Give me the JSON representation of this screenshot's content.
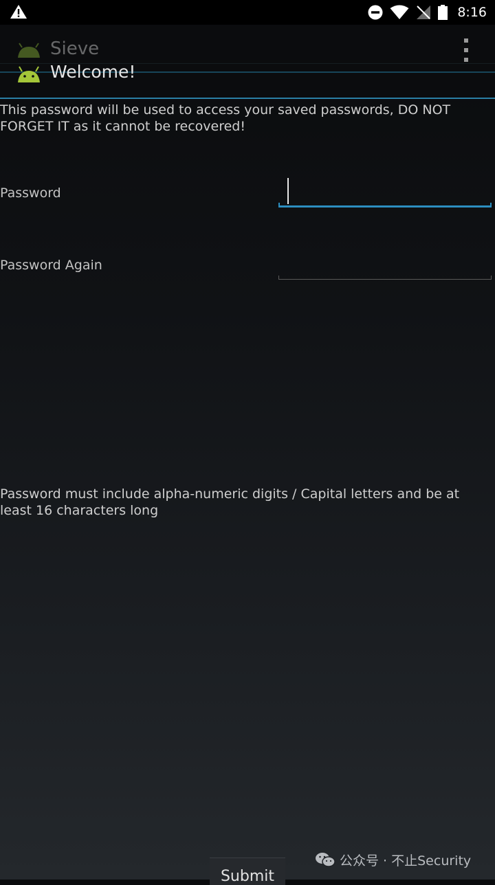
{
  "status_bar": {
    "time": "8:16",
    "icons": [
      "warning-icon",
      "do-not-disturb-icon",
      "wifi-icon",
      "no-signal-icon",
      "battery-icon"
    ]
  },
  "action_bar": {
    "app_title": "Sieve",
    "page_title": "Welcome!",
    "menu_icon": "overflow-menu-icon"
  },
  "form": {
    "intro_text": "This password will be used to access your saved passwords, DO NOT FORGET IT as it cannot be recovered!",
    "password_label": "Password",
    "password_value": "",
    "password_again_label": "Password Again",
    "password_again_value": "",
    "hint_text": "Password must include alpha-numeric digits / Capital letters and be at least 16 characters long",
    "submit_label": "Submit"
  },
  "watermark": {
    "text": "公众号 · 不止Security",
    "icon": "wechat-icon"
  },
  "colors": {
    "accent": "#2c8ec0",
    "background_top": "#0a0b0d",
    "background_bottom": "#24282c",
    "android_green": "#a4c639"
  }
}
